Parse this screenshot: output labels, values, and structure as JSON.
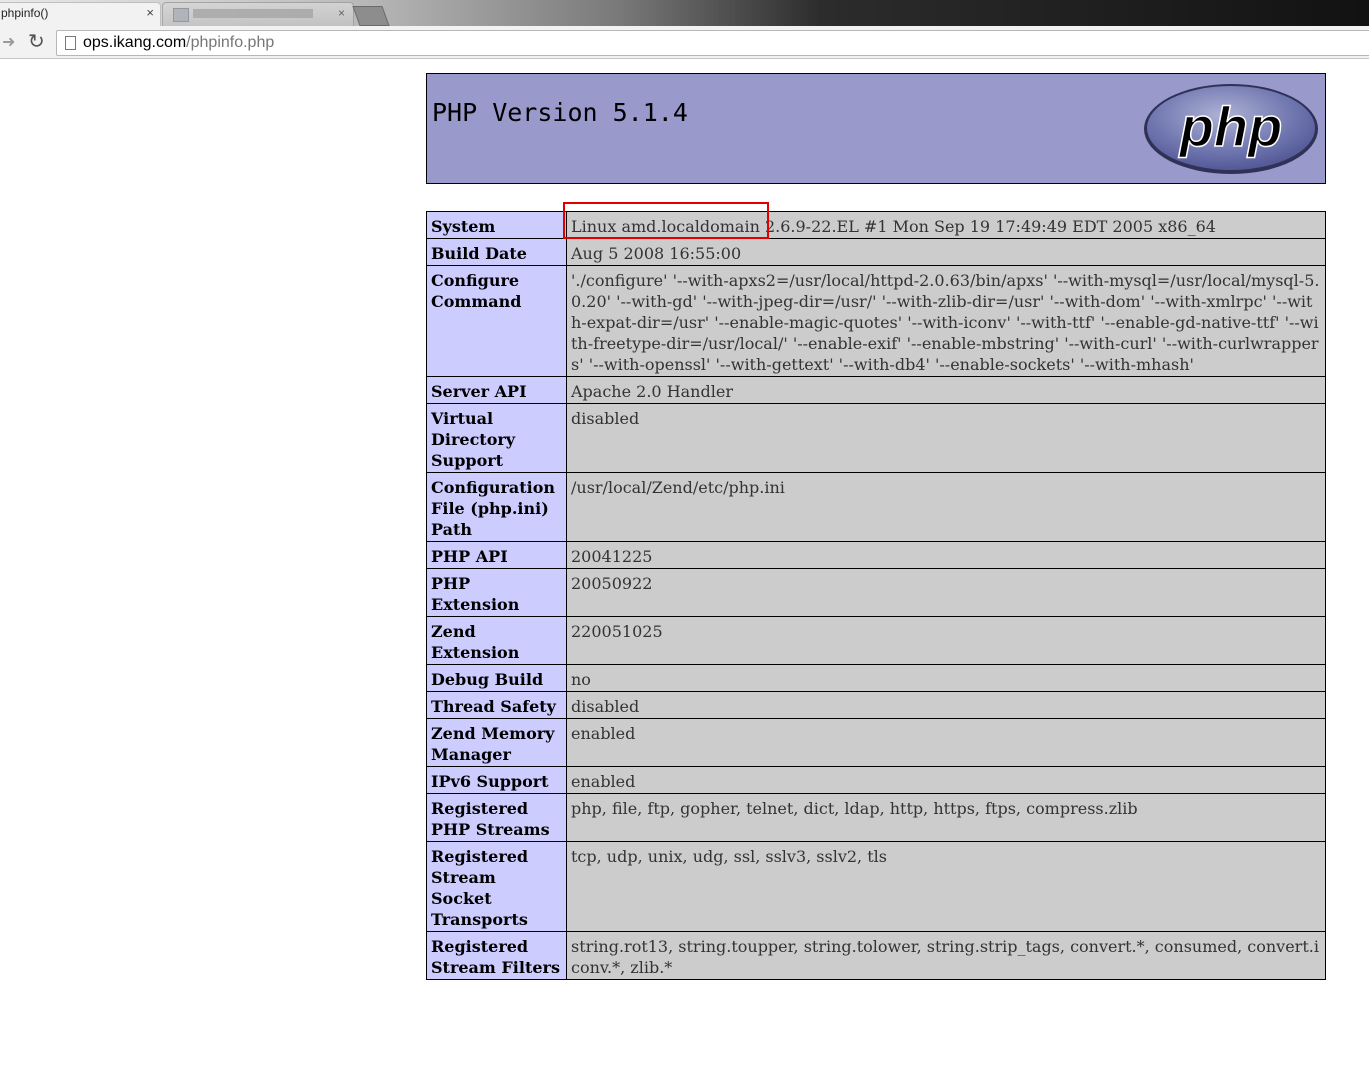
{
  "browser": {
    "active_tab": {
      "title": "phpinfo()",
      "close_glyph": "×"
    },
    "inactive_tab": {
      "close_glyph": "×"
    },
    "address": {
      "host": "ops.ikang.com",
      "path": "/phpinfo.php"
    },
    "icons": [
      "forward-icon",
      "reload-icon",
      "page-icon"
    ]
  },
  "page": {
    "title": "PHP Version 5.1.4",
    "logo_text": "php",
    "rows": [
      {
        "label": "System",
        "value": "Linux amd.localdomain 2.6.9-22.EL #1 Mon Sep 19 17:49:49 EDT 2005 x86_64"
      },
      {
        "label": "Build Date",
        "value": "Aug 5 2008 16:55:00"
      },
      {
        "label": "Configure Command",
        "value": "'./configure' '--with-apxs2=/usr/local/httpd-2.0.63/bin/apxs' '--with-mysql=/usr/local/mysql-5.0.20' '--with-gd' '--with-jpeg-dir=/usr/' '--with-zlib-dir=/usr' '--with-dom' '--with-xmlrpc' '--with-expat-dir=/usr' '--enable-magic-quotes' '--with-iconv' '--with-ttf' '--enable-gd-native-ttf' '--with-freetype-dir=/usr/local/' '--enable-exif' '--enable-mbstring' '--with-curl' '--with-curlwrappers' '--with-openssl' '--with-gettext' '--with-db4' '--enable-sockets' '--with-mhash'"
      },
      {
        "label": "Server API",
        "value": "Apache 2.0 Handler"
      },
      {
        "label": "Virtual Directory Support",
        "value": "disabled"
      },
      {
        "label": "Configuration File (php.ini) Path",
        "value": "/usr/local/Zend/etc/php.ini"
      },
      {
        "label": "PHP API",
        "value": "20041225"
      },
      {
        "label": "PHP Extension",
        "value": "20050922"
      },
      {
        "label": "Zend Extension",
        "value": "220051025"
      },
      {
        "label": "Debug Build",
        "value": "no"
      },
      {
        "label": "Thread Safety",
        "value": "disabled"
      },
      {
        "label": "Zend Memory Manager",
        "value": "enabled"
      },
      {
        "label": "IPv6 Support",
        "value": "enabled"
      },
      {
        "label": "Registered PHP Streams",
        "value": "php, file, ftp, gopher, telnet, dict, ldap, http, https, ftps, compress.zlib"
      },
      {
        "label": "Registered Stream Socket Transports",
        "value": "tcp, udp, unix, udg, ssl, sslv3, sslv2, tls"
      },
      {
        "label": "Registered Stream Filters",
        "value": "string.rot13, string.toupper, string.tolower, string.strip_tags, convert.*, consumed, convert.iconv.*, zlib.*"
      }
    ]
  },
  "colors": {
    "header_bg": "#9999cc",
    "label_bg": "#ccccff",
    "value_bg": "#cccccc",
    "highlight": "#e00000"
  }
}
